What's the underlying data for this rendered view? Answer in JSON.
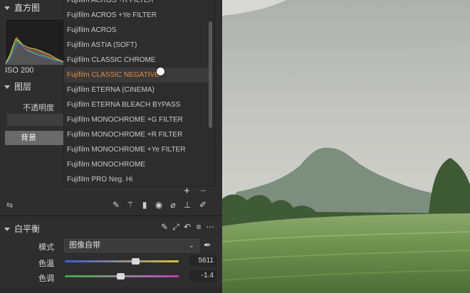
{
  "panels": {
    "histogram": {
      "title": "直方图",
      "iso": "ISO 200"
    },
    "layers": {
      "title": "图层",
      "opacity_label": "不透明度",
      "background_layer": "背景",
      "add_label": "+",
      "remove_label": "−"
    },
    "white_balance": {
      "title": "白平衡",
      "mode_label": "模式",
      "mode_value": "图像自带",
      "temperature_label": "色温",
      "temperature_value": "5611",
      "temperature_fraction": 0.62,
      "tint_label": "色调",
      "tint_value": "-1.4",
      "tint_fraction": 0.49
    }
  },
  "film_menu": {
    "items": [
      "Fujifilm ACROS +R FILTER",
      "Fujifilm ACROS +Ye FILTER",
      "Fujifilm ACROS",
      "Fujifilm ASTIA (SOFT)",
      "Fujifilm CLASSIC CHROME",
      "Fujifilm CLASSIC NEGATIVE",
      "Fujifilm ETERNA (CINEMA)",
      "Fujifilm ETERNA BLEACH BYPASS",
      "Fujifilm MONOCHROME +G FILTER",
      "Fujifilm MONOCHROME +R FILTER",
      "Fujifilm MONOCHROME +Ye FILTER",
      "Fujifilm MONOCHROME",
      "Fujifilm PRO Neg. Hi"
    ],
    "selected_index": 5,
    "selected_color": "#e48a3c"
  },
  "icons": {
    "layer_tools": [
      "brush-icon",
      "magic-brush-icon",
      "gradient-icon",
      "radial-icon",
      "eraser-icon",
      "stamp-icon",
      "pen-icon"
    ],
    "wb_tools": [
      "pen-icon",
      "expand-icon",
      "undo-icon",
      "list-icon",
      "more-icon"
    ]
  }
}
